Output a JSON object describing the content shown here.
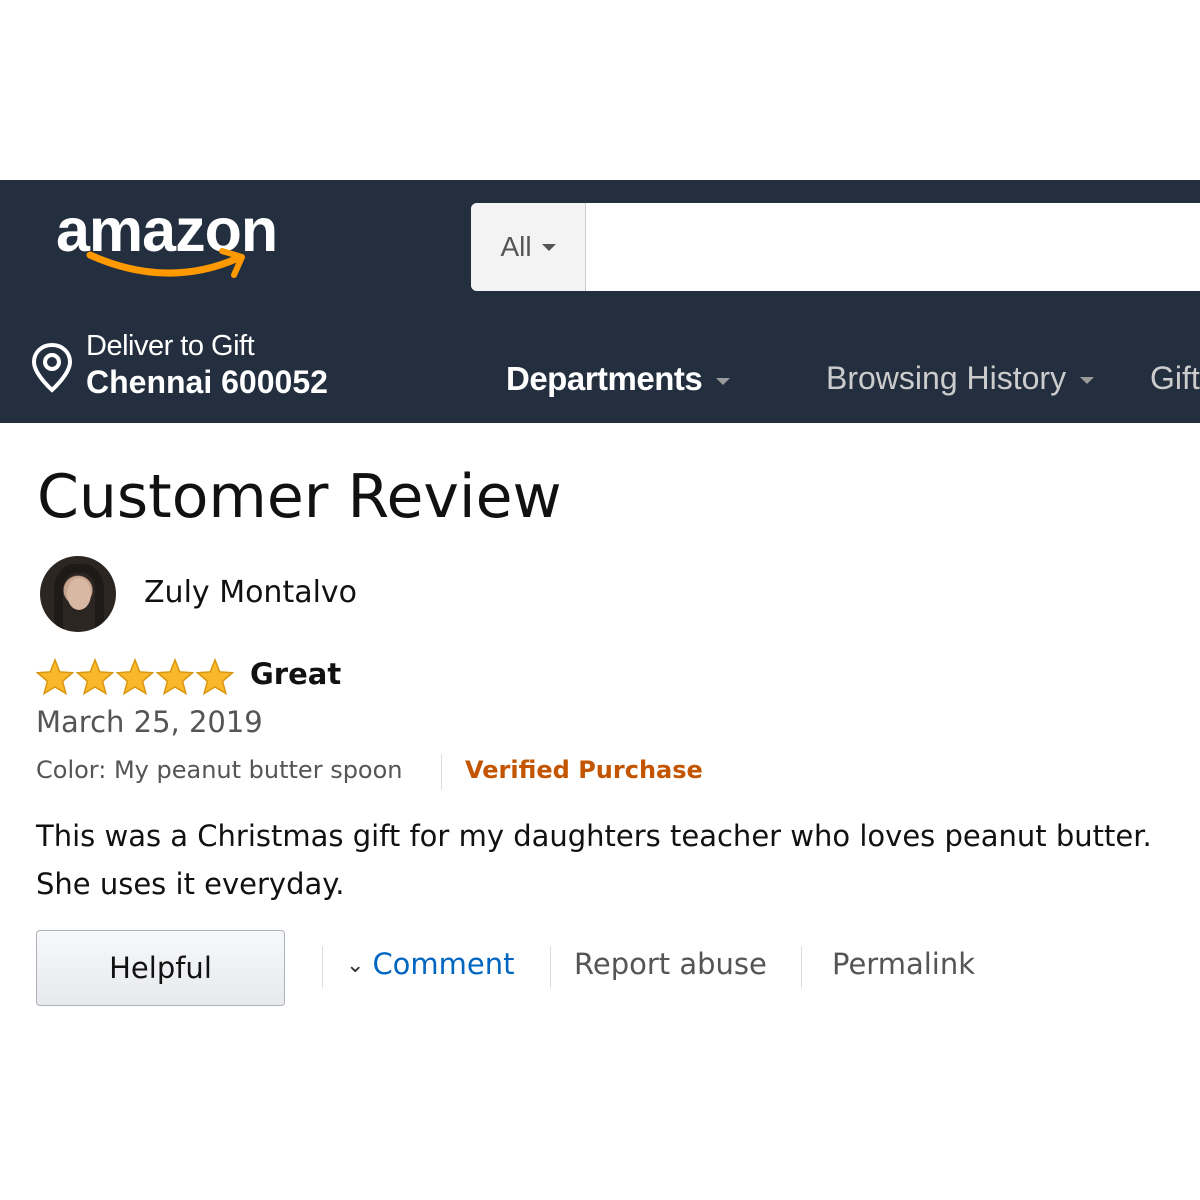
{
  "header": {
    "logo_text": "amazon",
    "search": {
      "category": "All",
      "placeholder": ""
    },
    "deliver": {
      "line1": "Deliver to Gift",
      "line2": "Chennai 600052"
    },
    "nav": {
      "departments": "Departments",
      "browsing_history": "Browsing History",
      "gift": "Gift"
    },
    "colors": {
      "nav_bg": "#232f3e",
      "smile": "#f90"
    }
  },
  "review": {
    "page_title": "Customer Review",
    "reviewer_name": "Zuly Montalvo",
    "rating": 5,
    "rating_max": 5,
    "title": "Great",
    "date": "March 25, 2019",
    "color_label": "Color: My peanut butter spoon",
    "verified": "Verified Purchase",
    "body_line1": "This was a Christmas gift for my daughters teacher who loves peanut butter.",
    "body_line2": "She uses it everyday.",
    "actions": {
      "helpful": "Helpful",
      "comment": "Comment",
      "report": "Report abuse",
      "permalink": "Permalink"
    },
    "colors": {
      "star": "#f9b82b",
      "verified": "#c45500",
      "link": "#0066c0"
    }
  }
}
